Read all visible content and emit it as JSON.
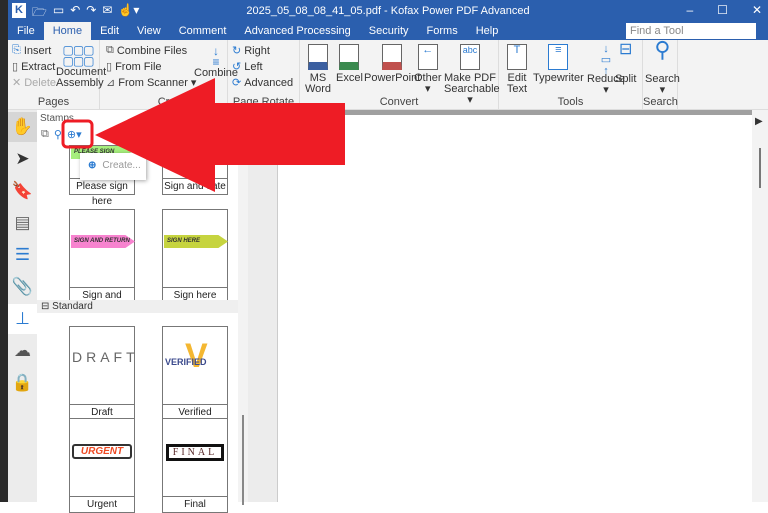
{
  "window": {
    "title": "2025_05_08_08_41_05.pdf - Kofax Power PDF Advanced",
    "logo": "K",
    "controls": [
      "–",
      "☐",
      "✕"
    ]
  },
  "menu": [
    "File",
    "Home",
    "Edit",
    "View",
    "Comment",
    "Advanced Processing",
    "Security",
    "Forms",
    "Help"
  ],
  "find_tool": {
    "placeholder": "Find a Tool"
  },
  "ribbon": {
    "pages": {
      "label": "Pages",
      "insert": "Insert",
      "extract": "Extract",
      "delete": "Delete",
      "assembly": "Document Assembly"
    },
    "create": {
      "label": "Cr",
      "combine_files": "Combine Files",
      "from_file": "From File",
      "from_scanner": "From Scanner",
      "combine": "Combine"
    },
    "rotate": {
      "label": "Page Rotate",
      "right": "Right",
      "left": "Left",
      "advanced": "Advanced"
    },
    "convert": {
      "label": "Convert",
      "items": [
        "MS Word",
        "Excel",
        "PowerPoint",
        "Other",
        "Make PDF Searchable"
      ]
    },
    "tools": {
      "label": "Tools",
      "items": [
        "Edit Text",
        "Typewriter",
        "Reduce",
        "Split"
      ]
    },
    "search": {
      "label": "Search",
      "item": "Search"
    }
  },
  "panel": {
    "title": "Stamps",
    "dropdown_item": "Create...",
    "custom": [
      {
        "label": "Please sign here",
        "tag": "PLEASE SIGN HERE"
      },
      {
        "label": "Sign and date",
        "tag": ""
      },
      {
        "label": "Sign and return",
        "tag": "SIGN AND RETURN"
      },
      {
        "label": "Sign here",
        "tag": "SIGN HERE"
      }
    ],
    "section": "Standard",
    "standard": [
      {
        "label": "Draft",
        "art": "DRAFT"
      },
      {
        "label": "Verified",
        "art": "VERIFIED"
      },
      {
        "label": "Urgent",
        "art": "URGENT"
      },
      {
        "label": "Final",
        "art": "FINAL"
      }
    ]
  },
  "colors": {
    "brand": "#2b5fae",
    "accent": "#2b7bd1",
    "annotation": "#ee1c25"
  }
}
